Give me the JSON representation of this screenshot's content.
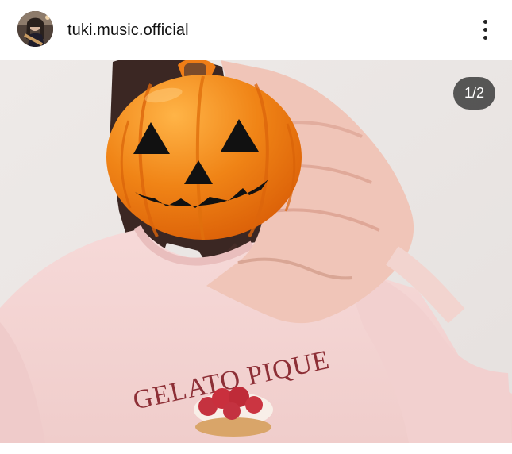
{
  "post": {
    "username": "tuki.music.official",
    "avatar_icon": "profile-avatar",
    "more_icon": "more-vertical-icon"
  },
  "media": {
    "counter": "1/2",
    "shirt_print": "GELATO PIQUE",
    "accent_pumpkin": "#f07a12",
    "accent_shirt": "#f3d3d2"
  }
}
